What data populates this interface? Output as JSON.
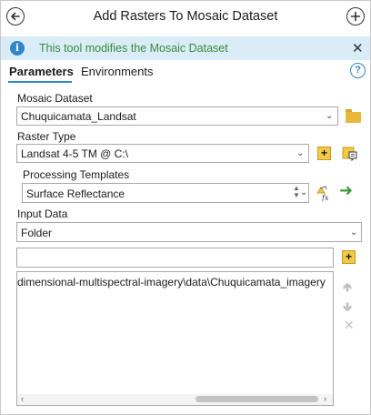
{
  "header": {
    "title": "Add Rasters To Mosaic Dataset",
    "back_icon": "arrow-left-icon",
    "add_icon": "plus-circle-icon"
  },
  "info_bar": {
    "text": "This tool modifies the Mosaic Dataset",
    "icon": "info-icon",
    "close_glyph": "✕"
  },
  "tabs": [
    {
      "label": "Parameters",
      "active": true
    },
    {
      "label": "Environments",
      "active": false
    }
  ],
  "help_glyph": "?",
  "mosaic_dataset": {
    "label": "Mosaic Dataset",
    "value": "Chuquicamata_Landsat"
  },
  "raster_type": {
    "label": "Raster Type",
    "value": "Landsat 4-5 TM @ C:\\"
  },
  "processing_templates": {
    "label": "Processing Templates",
    "value": "Surface Reflectance"
  },
  "input_data": {
    "label": "Input Data",
    "value": "Folder"
  },
  "path_input": {
    "value": ""
  },
  "paths_list": {
    "items": [
      "dimensional-multispectral-imagery\\data\\Chuquicamata_imagery"
    ]
  },
  "colors": {
    "accent": "#2f86c9",
    "info_bg": "#d9ecf7",
    "info_text": "#3a8a3a"
  }
}
